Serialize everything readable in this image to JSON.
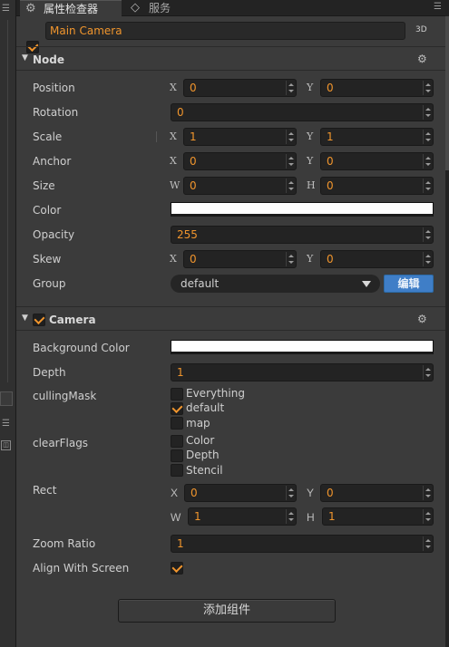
{
  "tabs": [
    {
      "label": "属性检查器",
      "icon": "gear-icon",
      "active": true
    },
    {
      "label": "服务",
      "icon": "service-icon",
      "active": false
    }
  ],
  "node_name": "Main Camera",
  "node_active": true,
  "badge": "3D",
  "node_section": {
    "title": "Node",
    "labels": {
      "position": "Position",
      "rotation": "Rotation",
      "scale": "Scale",
      "anchor": "Anchor",
      "size": "Size",
      "color": "Color",
      "opacity": "Opacity",
      "skew": "Skew",
      "group": "Group"
    },
    "axes": {
      "x": "X",
      "y": "Y",
      "w": "W",
      "h": "H"
    },
    "values": {
      "position_x": "0",
      "position_y": "0",
      "rotation": "0",
      "scale_x": "1",
      "scale_y": "1",
      "anchor_x": "0",
      "anchor_y": "0",
      "size_w": "0",
      "size_h": "0",
      "color": "#ffffff",
      "opacity": "255",
      "skew_x": "0",
      "skew_y": "0",
      "group": "default"
    },
    "edit_label": "编辑"
  },
  "camera_section": {
    "title": "Camera",
    "enabled": true,
    "labels": {
      "background_color": "Background Color",
      "depth": "Depth",
      "culling_mask": "cullingMask",
      "clear_flags": "clearFlags",
      "rect": "Rect",
      "zoom_ratio": "Zoom Ratio",
      "align_with_screen": "Align With Screen"
    },
    "values": {
      "background_color": "#ffffff",
      "depth": "1",
      "rect_x": "0",
      "rect_y": "0",
      "rect_w": "1",
      "rect_h": "1",
      "zoom_ratio": "1",
      "align_with_screen": true
    },
    "culling_mask_options": [
      {
        "label": "Everything",
        "checked": false
      },
      {
        "label": "default",
        "checked": true
      },
      {
        "label": "map",
        "checked": false
      }
    ],
    "clear_flags_options": [
      {
        "label": "Color",
        "checked": false
      },
      {
        "label": "Depth",
        "checked": false
      },
      {
        "label": "Stencil",
        "checked": false
      }
    ]
  },
  "add_component_label": "添加组件",
  "accent_color": "#f0952d",
  "edit_button_color": "#3f7ec7"
}
